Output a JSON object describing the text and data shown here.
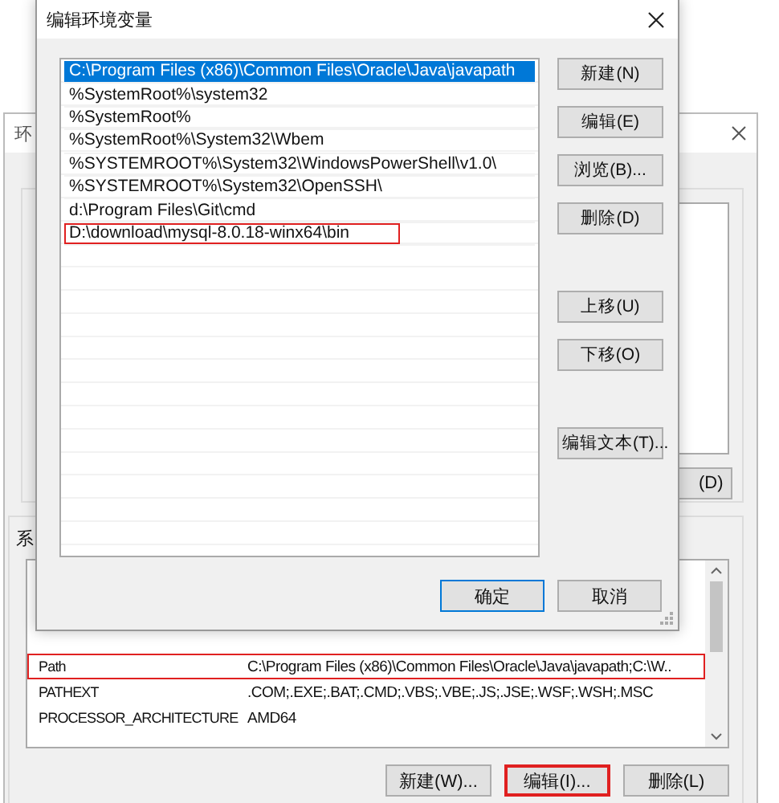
{
  "back_window": {
    "title": "环",
    "group_label": "系",
    "partial_button": {
      "label": "(D)"
    },
    "system_variables": {
      "rows": [
        {
          "name": "Path",
          "value": "C:\\Program Files (x86)\\Common Files\\Oracle\\Java\\javapath;C:\\W..",
          "highlighted": true
        },
        {
          "name": "PATHEXT",
          "value": ".COM;.EXE;.BAT;.CMD;.VBS;.VBE;.JS;.JSE;.WSF;.WSH;.MSC",
          "highlighted": false
        },
        {
          "name": "PROCESSOR_ARCHITECTURE",
          "value": "AMD64",
          "highlighted": false
        }
      ]
    },
    "buttons": [
      {
        "label": "新建(W)...",
        "highlighted": false
      },
      {
        "label": "编辑(I)...",
        "highlighted": true
      },
      {
        "label": "删除(L)",
        "highlighted": false
      }
    ]
  },
  "dialog": {
    "title": "编辑环境变量",
    "paths": [
      {
        "text": "C:\\Program Files (x86)\\Common Files\\Oracle\\Java\\javapath",
        "selected": true,
        "highlighted": false
      },
      {
        "text": "%SystemRoot%\\system32",
        "selected": false,
        "highlighted": false
      },
      {
        "text": "%SystemRoot%",
        "selected": false,
        "highlighted": false
      },
      {
        "text": "%SystemRoot%\\System32\\Wbem",
        "selected": false,
        "highlighted": false
      },
      {
        "text": "%SYSTEMROOT%\\System32\\WindowsPowerShell\\v1.0\\",
        "selected": false,
        "highlighted": false
      },
      {
        "text": "%SYSTEMROOT%\\System32\\OpenSSH\\",
        "selected": false,
        "highlighted": false
      },
      {
        "text": "d:\\Program Files\\Git\\cmd",
        "selected": false,
        "highlighted": false
      },
      {
        "text": "D:\\download\\mysql-8.0.18-winx64\\bin",
        "selected": false,
        "highlighted": true
      }
    ],
    "side_button_groups": [
      [
        {
          "label": "新建(N)"
        },
        {
          "label": "编辑(E)"
        },
        {
          "label": "浏览(B)..."
        },
        {
          "label": "删除(D)"
        }
      ],
      [
        {
          "label": "上移(U)"
        },
        {
          "label": "下移(O)"
        }
      ],
      [
        {
          "label": "编辑文本(T)..."
        }
      ]
    ],
    "ok": {
      "label": "确定",
      "default": true
    },
    "cancel": {
      "label": "取消",
      "default": false
    }
  }
}
